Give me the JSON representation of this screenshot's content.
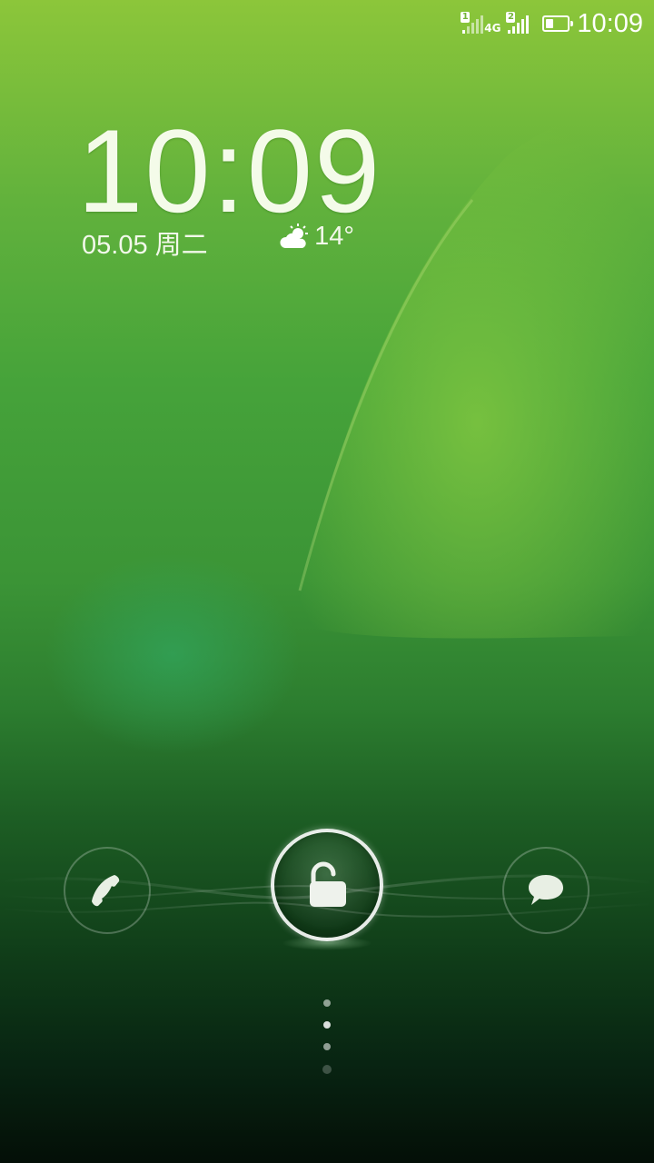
{
  "status_bar": {
    "sim1_label": "1",
    "sim2_label": "2",
    "network_type": "4G",
    "battery_level": 0.35,
    "time": "10:09",
    "icons": [
      "signal-sim1-icon",
      "signal-sim2-icon",
      "battery-icon"
    ]
  },
  "lockscreen": {
    "clock": "10:09",
    "date": "05.05 周二",
    "weather_icon": "partly-cloudy-icon",
    "temperature": "14°"
  },
  "dock": {
    "left_icon": "phone-icon",
    "center_icon": "unlock-icon",
    "right_icon": "message-icon"
  },
  "pager": {
    "count": 4,
    "active_index": 1
  },
  "colors": {
    "wallpaper_top": "#8cc63a",
    "wallpaper_bottom": "#040f07",
    "foreground": "#ffffff"
  }
}
